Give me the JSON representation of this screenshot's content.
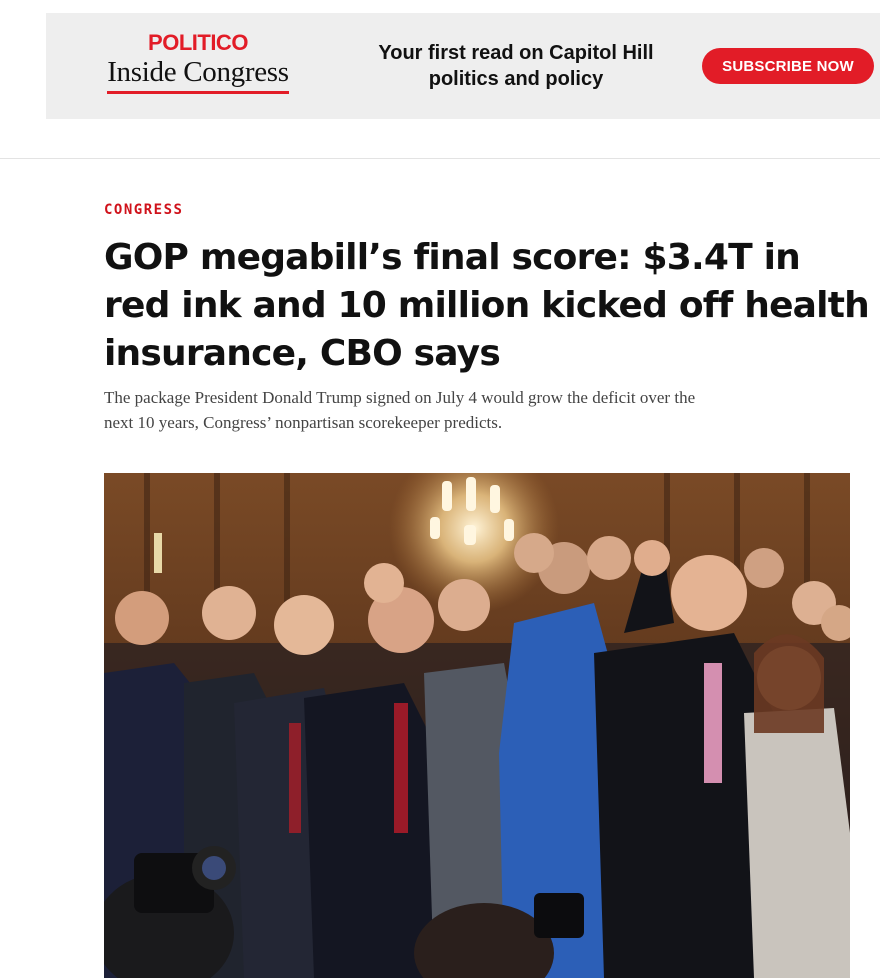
{
  "promo": {
    "brand_top": "POLITICO",
    "brand_name": "Inside Congress",
    "tagline_line1": "Your first read on Capitol Hill",
    "tagline_line2": "politics and policy",
    "subscribe_label": "SUBSCRIBE NOW"
  },
  "article": {
    "kicker": "CONGRESS",
    "headline_line1": "GOP megabill’s final score: $3.4T in",
    "headline_line2": "red ink and 10 million kicked off health",
    "headline_line3": "insurance, CBO says",
    "dek_line1": "The package President Donald Trump signed on July 4 would grow the deficit over the",
    "dek_line2": "next 10 years, Congress’ nonpartisan scorekeeper predicts."
  },
  "colors": {
    "accent": "#e21c27",
    "kicker": "#d0121b",
    "promo_bg": "#eeeeee"
  }
}
